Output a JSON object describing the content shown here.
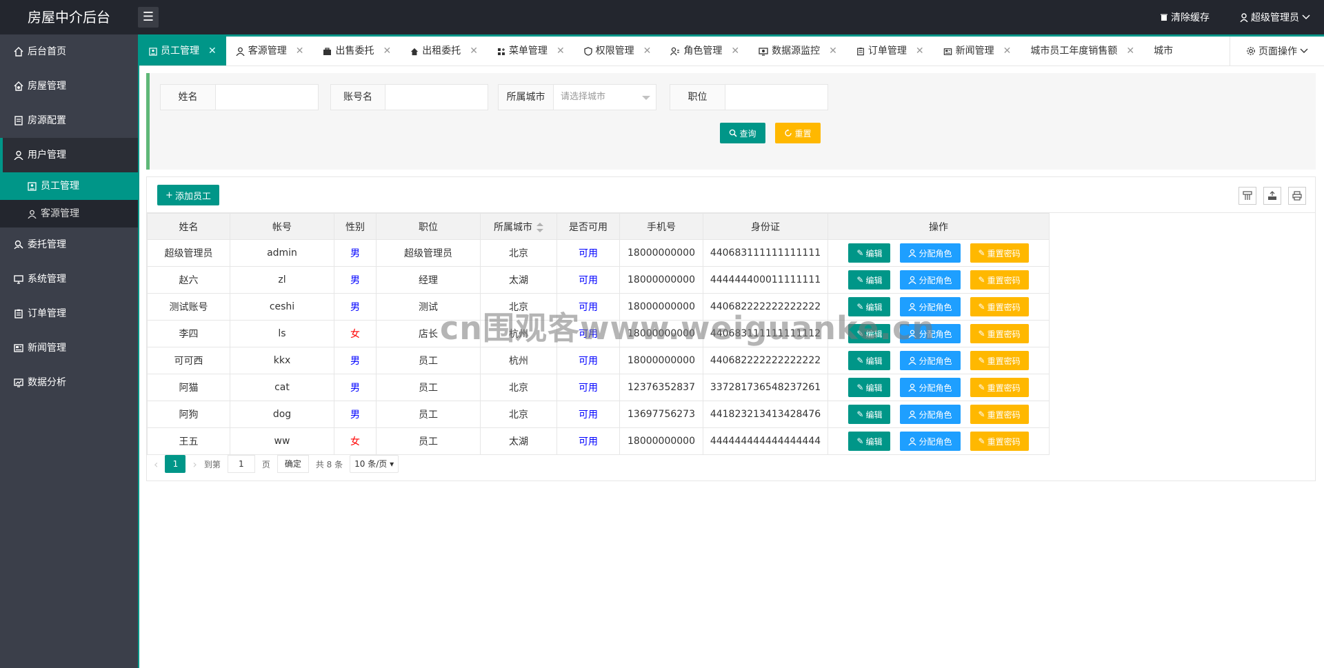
{
  "header": {
    "logo": "房屋中介后台",
    "menu_toggle_glyph": "☰",
    "clear_cache": "清除缓存",
    "user": "超级管理员"
  },
  "sidebar": {
    "items": [
      {
        "label": "后台首页",
        "icon": "home-icon"
      },
      {
        "label": "房屋管理",
        "icon": "house-gear-icon"
      },
      {
        "label": "房源配置",
        "icon": "document-icon"
      },
      {
        "label": "用户管理",
        "icon": "user-icon"
      },
      {
        "label": "委托管理",
        "icon": "search-user-icon"
      },
      {
        "label": "系统管理",
        "icon": "monitor-icon"
      },
      {
        "label": "订单管理",
        "icon": "clipboard-icon"
      },
      {
        "label": "新闻管理",
        "icon": "news-icon"
      },
      {
        "label": "数据分析",
        "icon": "chart-icon"
      }
    ],
    "sub_items": [
      {
        "label": "员工管理",
        "icon": "id-card-icon"
      },
      {
        "label": "客源管理",
        "icon": "user-icon"
      }
    ]
  },
  "tabs": [
    {
      "label": "员工管理"
    },
    {
      "label": "客源管理"
    },
    {
      "label": "出售委托"
    },
    {
      "label": "出租委托"
    },
    {
      "label": "菜单管理"
    },
    {
      "label": "权限管理"
    },
    {
      "label": "角色管理"
    },
    {
      "label": "数据源监控"
    },
    {
      "label": "订单管理"
    },
    {
      "label": "新闻管理"
    },
    {
      "label": "城市员工年度销售额"
    },
    {
      "label": "城市"
    }
  ],
  "page_ops": "页面操作",
  "search": {
    "name_label": "姓名",
    "account_label": "账号名",
    "city_label": "所属城市",
    "city_placeholder": "请选择城市",
    "position_label": "职位",
    "query_button": "查询",
    "reset_button": "重置"
  },
  "table": {
    "add_button": "添加员工",
    "columns": [
      "姓名",
      "帐号",
      "性别",
      "职位",
      "所属城市",
      "是否可用",
      "手机号",
      "身份证",
      "操作"
    ],
    "rows": [
      [
        "超级管理员",
        "admin",
        "男",
        "超级管理员",
        "北京",
        "可用",
        "18000000000",
        "440683111111111111"
      ],
      [
        "赵六",
        "zl",
        "男",
        "经理",
        "太湖",
        "可用",
        "18000000000",
        "444444400011111111"
      ],
      [
        "测试账号",
        "ceshi",
        "男",
        "测试",
        "北京",
        "可用",
        "18000000000",
        "440682222222222222"
      ],
      [
        "李四",
        "ls",
        "女",
        "店长",
        "杭州",
        "可用",
        "18000000000",
        "440683111111111112"
      ],
      [
        "可可西",
        "kkx",
        "男",
        "员工",
        "杭州",
        "可用",
        "18000000000",
        "440682222222222222"
      ],
      [
        "阿猫",
        "cat",
        "男",
        "员工",
        "北京",
        "可用",
        "12376352837",
        "337281736548237261"
      ],
      [
        "阿狗",
        "dog",
        "男",
        "员工",
        "北京",
        "可用",
        "13697756273",
        "441823213413428476"
      ],
      [
        "王五",
        "ww",
        "女",
        "员工",
        "太湖",
        "可用",
        "18000000000",
        "444444444444444444"
      ]
    ],
    "op_edit": "编辑",
    "op_role": "分配角色",
    "op_reset_pwd": "重置密码"
  },
  "pager": {
    "current": "1",
    "goto": "到第",
    "page_value": "1",
    "page_unit": "页",
    "confirm": "确定",
    "total": "共 8 条",
    "size": "10 条/页"
  },
  "watermark": "cn围观客www.weiguanke.cn",
  "colors": {
    "accent": "#009688",
    "warn": "#ffb800",
    "info": "#1e9fff",
    "sidebar": "#3b3f4a",
    "header": "#23262e"
  }
}
